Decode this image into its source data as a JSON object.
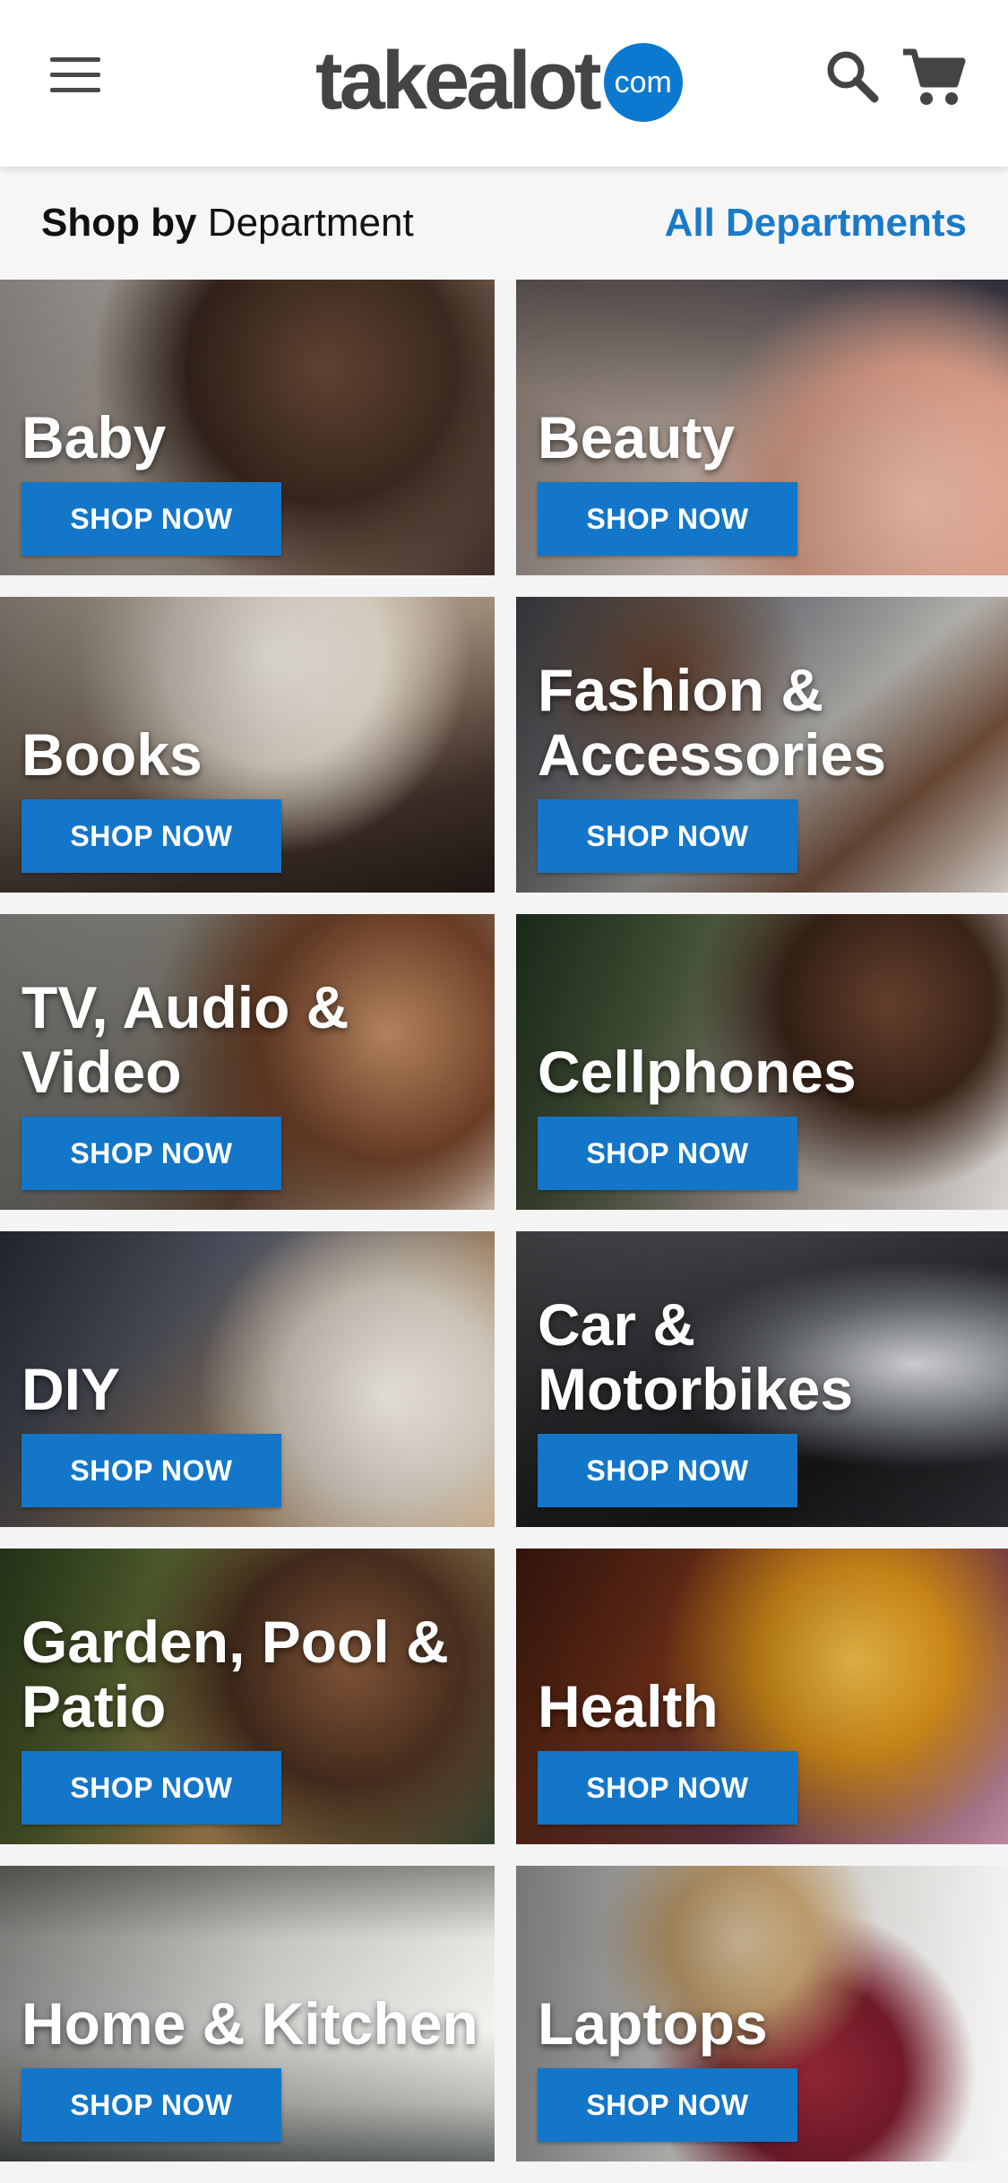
{
  "header": {
    "logo_word": "takealot",
    "logo_badge": "com",
    "icons": [
      "menu-icon",
      "search-icon",
      "cart-icon"
    ]
  },
  "departments_header": {
    "title_bold": "Shop by",
    "title_regular": "Department",
    "all_link": "All Departments"
  },
  "tiles": [
    {
      "title": "Baby",
      "button": "SHOP NOW"
    },
    {
      "title": "Beauty",
      "button": "SHOP NOW"
    },
    {
      "title": "Books",
      "button": "SHOP NOW"
    },
    {
      "title": "Fashion & Accessories",
      "button": "SHOP NOW"
    },
    {
      "title": "TV, Audio & Video",
      "button": "SHOP NOW"
    },
    {
      "title": "Cellphones",
      "button": "SHOP NOW"
    },
    {
      "title": "DIY",
      "button": "SHOP NOW"
    },
    {
      "title": "Car & Motorbikes",
      "button": "SHOP NOW"
    },
    {
      "title": "Garden, Pool & Patio",
      "button": "SHOP NOW"
    },
    {
      "title": "Health",
      "button": "SHOP NOW"
    },
    {
      "title": "Home & Kitchen",
      "button": "SHOP NOW"
    },
    {
      "title": "Laptops",
      "button": "SHOP NOW"
    }
  ],
  "colors": {
    "brand_blue": "#1376c8",
    "link_blue": "#1a7ac7",
    "logo_grey": "#444444"
  }
}
